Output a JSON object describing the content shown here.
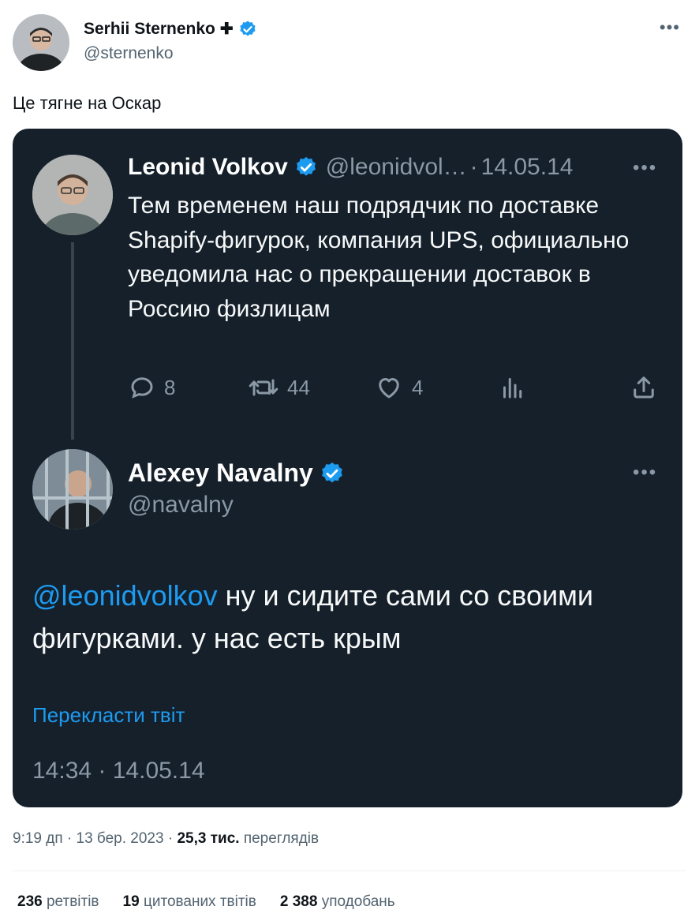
{
  "author": {
    "name": "Serhii Sternenko",
    "name_symbol": "✚",
    "handle": "@sternenko"
  },
  "tweet": {
    "text": "Це тягне на Оскар"
  },
  "embedded": {
    "quoted": {
      "name": "Leonid Volkov",
      "handle": "@leonidvol…",
      "separator": "·",
      "date": "14.05.14",
      "text": "Тем временем наш подрядчик по доставке Shapify-фигурок, компания UPS, официально уведомила нас о прекращении доставок в Россию физлицам",
      "actions": {
        "replies": "8",
        "retweets": "44",
        "likes": "4"
      }
    },
    "reply": {
      "name": "Alexey Navalny",
      "handle": "@navalny",
      "mention": "@leonidvolkov",
      "text": " ну и сидите сами со своими фигурками. у нас есть крым",
      "translate": "Перекласти твіт",
      "timestamp": "14:34 · 14.05.14"
    }
  },
  "meta": {
    "time_date": "9:19 дп · 13 бер. 2023 · ",
    "views_count": "25,3 тис.",
    "views_label": " переглядів"
  },
  "stats": {
    "retweets_count": "236",
    "retweets_label": "ретвітів",
    "quotes_count": "19",
    "quotes_label": "цитованих твітів",
    "likes_count": "2 388",
    "likes_label": "уподобань"
  },
  "colors": {
    "accent": "#1d9bf0",
    "card_bg": "#15202b",
    "verified": "#1d9bf0"
  }
}
